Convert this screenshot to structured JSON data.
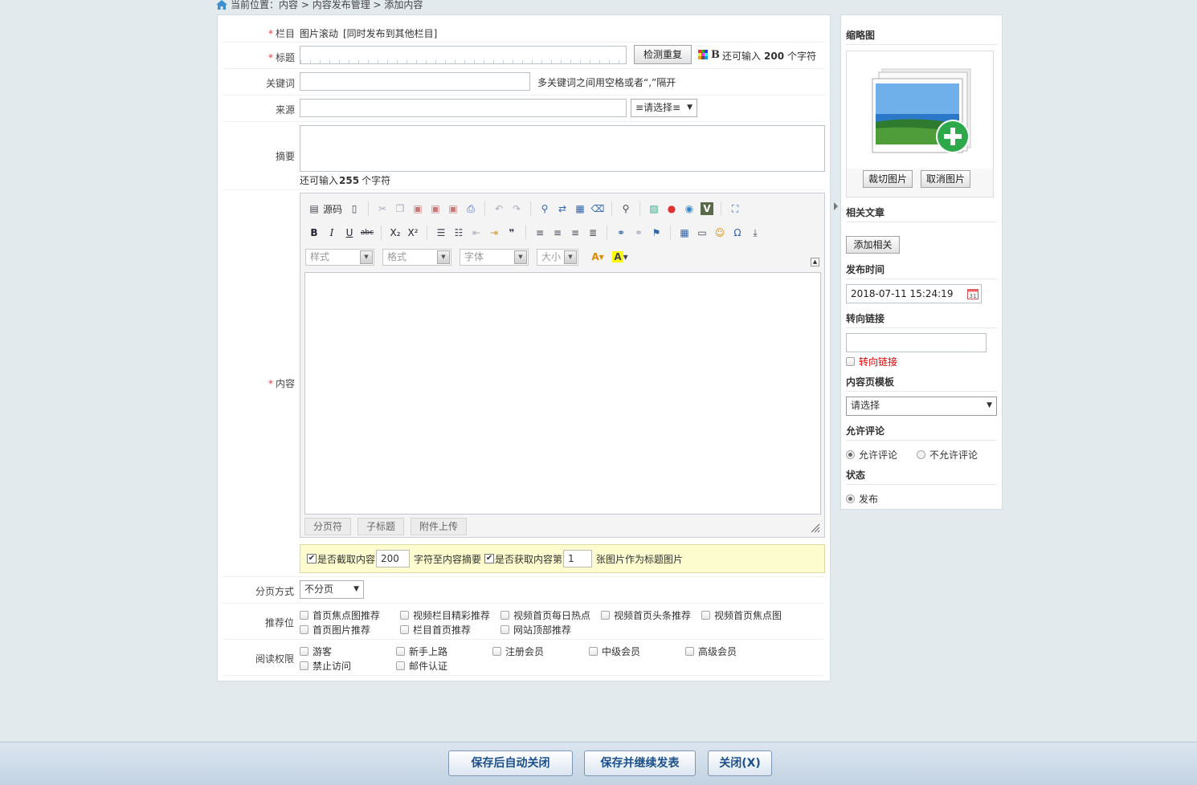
{
  "breadcrumb": {
    "prefix": "当前位置：",
    "path": "内容 > 内容发布管理 > 添加内容"
  },
  "form": {
    "category": {
      "label": "栏目",
      "value": "图片滚动",
      "extra": "[同时发布到其他栏目]"
    },
    "title": {
      "label": "标题",
      "check_button": "检测重复",
      "bold_mark": "B",
      "hint_prefix": "还可输入",
      "hint_count": "200",
      "hint_suffix": "个字符"
    },
    "keywords": {
      "label": "关键词",
      "hint": "多关键词之间用空格或者“,”隔开"
    },
    "source": {
      "label": "来源",
      "select": "≡请选择≡"
    },
    "summary": {
      "label": "摘要",
      "hint_prefix": "还可输入",
      "hint_count": "255",
      "hint_suffix": "个字符"
    },
    "content": {
      "label": "内容",
      "toolbar": {
        "source": "源码",
        "style": "样式",
        "format": "格式",
        "font": "字体",
        "size": "大小"
      },
      "tabs": [
        "分页符",
        "子标题",
        "附件上传"
      ]
    },
    "options": {
      "cut_label": "是否截取内容",
      "cut_value": "200",
      "cut_suffix": "字符至内容摘要",
      "img_label": "是否获取内容第",
      "img_value": "1",
      "img_suffix": "张图片作为标题图片"
    },
    "paging": {
      "label": "分页方式",
      "value": "不分页"
    },
    "position": {
      "label": "推荐位",
      "items": [
        "首页焦点图推荐",
        "视频栏目精彩推荐",
        "视频首页每日热点",
        "视频首页头条推荐",
        "视频首页焦点图",
        "首页图片推荐",
        "栏目首页推荐",
        "网站顶部推荐"
      ]
    },
    "permission": {
      "label": "阅读权限",
      "items": [
        "游客",
        "新手上路",
        "注册会员",
        "中级会员",
        "高级会员",
        "禁止访问",
        "邮件认证"
      ]
    }
  },
  "sidebar": {
    "thumb_title": "缩略图",
    "crop_button": "裁切图片",
    "cancel_button": "取消图片",
    "related_title": "相关文章",
    "add_related_button": "添加相关",
    "publish_title": "发布时间",
    "publish_value": "2018-07-11 15:24:19",
    "redirect_title": "转向链接",
    "redirect_check": "转向链接",
    "template_title": "内容页模板",
    "template_value": "请选择",
    "comment_title": "允许评论",
    "comment_yes": "允许评论",
    "comment_no": "不允许评论",
    "status_title": "状态",
    "status_value": "发布"
  },
  "footer": {
    "save_close": "保存后自动关闭",
    "save_continue": "保存并继续发表",
    "close": "关闭(X)"
  },
  "colors": {
    "required": "#e4393c",
    "footer_text": "#1a4f8c",
    "options_bg": "#fcfccf"
  }
}
